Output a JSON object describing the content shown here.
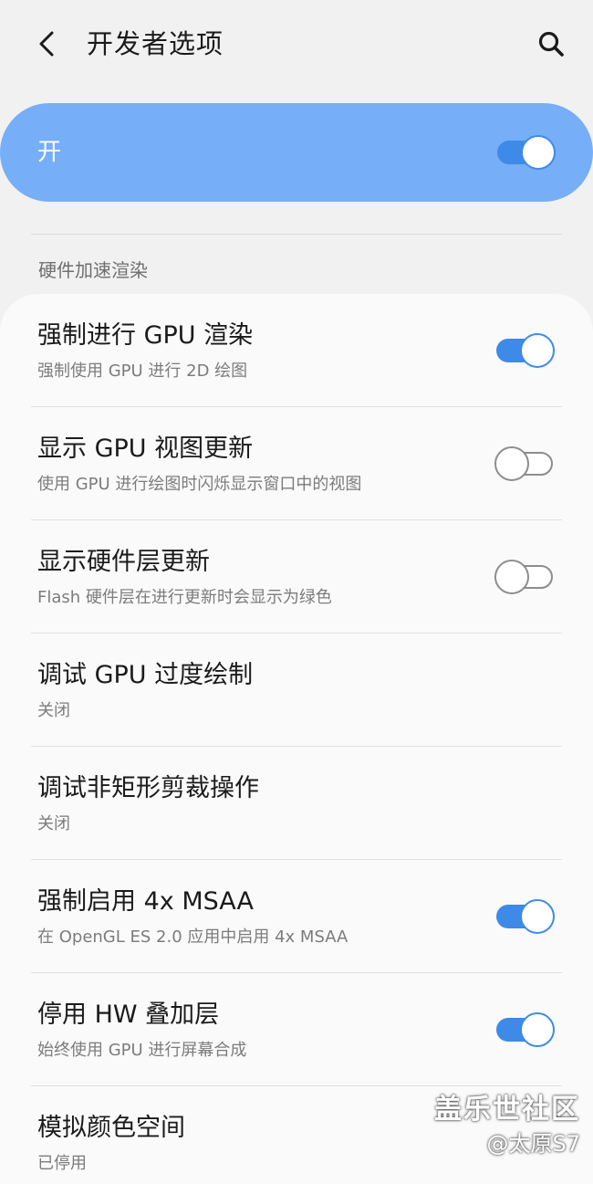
{
  "header": {
    "title": "开发者选项",
    "back_icon": "back-arrow-icon",
    "search_icon": "search-icon"
  },
  "master": {
    "label": "开",
    "enabled": true
  },
  "section": {
    "title": "硬件加速渲染"
  },
  "items": [
    {
      "title": "强制进行 GPU 渲染",
      "subtitle": "强制使用 GPU 进行 2D 绘图",
      "toggle": true,
      "state": "on"
    },
    {
      "title": "显示 GPU 视图更新",
      "subtitle": "使用 GPU 进行绘图时闪烁显示窗口中的视图",
      "toggle": true,
      "state": "off"
    },
    {
      "title": "显示硬件层更新",
      "subtitle": "Flash 硬件层在进行更新时会显示为绿色",
      "toggle": true,
      "state": "off"
    },
    {
      "title": "调试 GPU 过度绘制",
      "subtitle": "关闭",
      "toggle": false,
      "state": ""
    },
    {
      "title": "调试非矩形剪裁操作",
      "subtitle": "关闭",
      "toggle": false,
      "state": ""
    },
    {
      "title": "强制启用 4x MSAA",
      "subtitle": "在 OpenGL ES 2.0 应用中启用 4x MSAA",
      "toggle": true,
      "state": "on"
    },
    {
      "title": "停用 HW 叠加层",
      "subtitle": "始终使用 GPU 进行屏幕合成",
      "toggle": true,
      "state": "on"
    },
    {
      "title": "模拟颜色空间",
      "subtitle": "已停用",
      "toggle": false,
      "state": ""
    }
  ],
  "watermark": {
    "line1": "盖乐世社区",
    "line2": "@太原S7"
  },
  "colors": {
    "accent": "#3e8ae8",
    "master_bar": "#76aef8",
    "background": "#f1f1f1",
    "card": "#fafafa"
  }
}
